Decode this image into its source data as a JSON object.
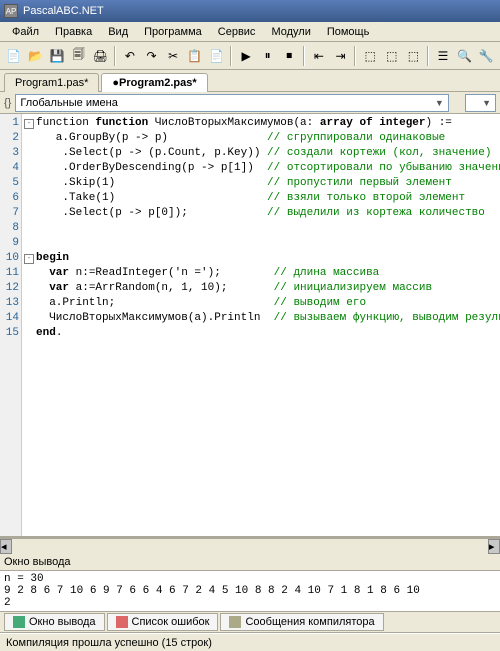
{
  "window": {
    "title": "PascalABC.NET"
  },
  "menu": [
    "Файл",
    "Правка",
    "Вид",
    "Программа",
    "Сервис",
    "Модули",
    "Помощь"
  ],
  "toolbar_icons": [
    "📄",
    "📂",
    "💾",
    "🗐",
    "🖨",
    "|",
    "↶",
    "↷",
    "✂",
    "📋",
    "📄",
    "|",
    "▶",
    "⏸",
    "⏹",
    "|",
    "⇤",
    "⇥",
    "|",
    "⬚",
    "⬚",
    "⬚",
    "|",
    "☰",
    "🔍",
    "🔧"
  ],
  "tabs": [
    {
      "label": "Program1.pas*",
      "active": false
    },
    {
      "label": "●Program2.pas*",
      "active": true
    }
  ],
  "nav": {
    "icon": "{}",
    "label": "Глобальные имена"
  },
  "code_lines": [
    {
      "n": 1,
      "fold": "-",
      "t": "function ",
      "kw1": "function",
      "r": " ЧислоВторыхМаксимумов(a: ",
      "kw2": "array of integer",
      "r2": ") :="
    },
    {
      "n": 2,
      "t": "   a.GroupBy(p -> p)               ",
      "c": "// сгруппировали одинаковые"
    },
    {
      "n": 3,
      "t": "    .Select(p -> (p.Count, p.Key)) ",
      "c": "// создали кортежи (кол, значение)"
    },
    {
      "n": 4,
      "t": "    .OrderByDescending(p -> p[1])  ",
      "c": "// отсортировали по убыванию значений"
    },
    {
      "n": 5,
      "t": "    .Skip(1)                       ",
      "c": "// пропустили первый элемент"
    },
    {
      "n": 6,
      "t": "    .Take(1)                       ",
      "c": "// взяли только второй элемент"
    },
    {
      "n": 7,
      "t": "    .Select(p -> p[0]);            ",
      "c": "// выделили из кортежа количество"
    },
    {
      "n": 8,
      "t": ""
    },
    {
      "n": 9,
      "t": ""
    },
    {
      "n": 10,
      "fold": "-",
      "kw1": "begin"
    },
    {
      "n": 11,
      "t": "  ",
      "kw1": "var",
      "r": " n:=ReadInteger('n =');        ",
      "c": "// длина массива"
    },
    {
      "n": 12,
      "t": "  ",
      "kw1": "var",
      "r": " a:=ArrRandom(n, 1, 10);       ",
      "c": "// инициализируем массив"
    },
    {
      "n": 13,
      "t": "  a.Println;                        ",
      "c": "// выводим его"
    },
    {
      "n": 14,
      "t": "  ЧислоВторыхМаксимумов(a).Println  ",
      "c": "// вызываем функцию, выводим результат"
    },
    {
      "n": 15,
      "kw1": "end",
      "r": "."
    }
  ],
  "output": {
    "title": "Окно вывода",
    "lines": [
      "n = 30",
      "9 2 8 6 7 10 6 9 7 6 6 4 6 7 2 4 5 10 8 8 2 4 10 7 1 8 1 8 6 10",
      "2"
    ]
  },
  "bottom_tabs": [
    {
      "label": "Окно вывода",
      "color": "#4a7"
    },
    {
      "label": "Список ошибок",
      "color": "#d66"
    },
    {
      "label": "Сообщения компилятора",
      "color": "#aa8"
    }
  ],
  "status": "Компиляция прошла успешно (15 строк)"
}
